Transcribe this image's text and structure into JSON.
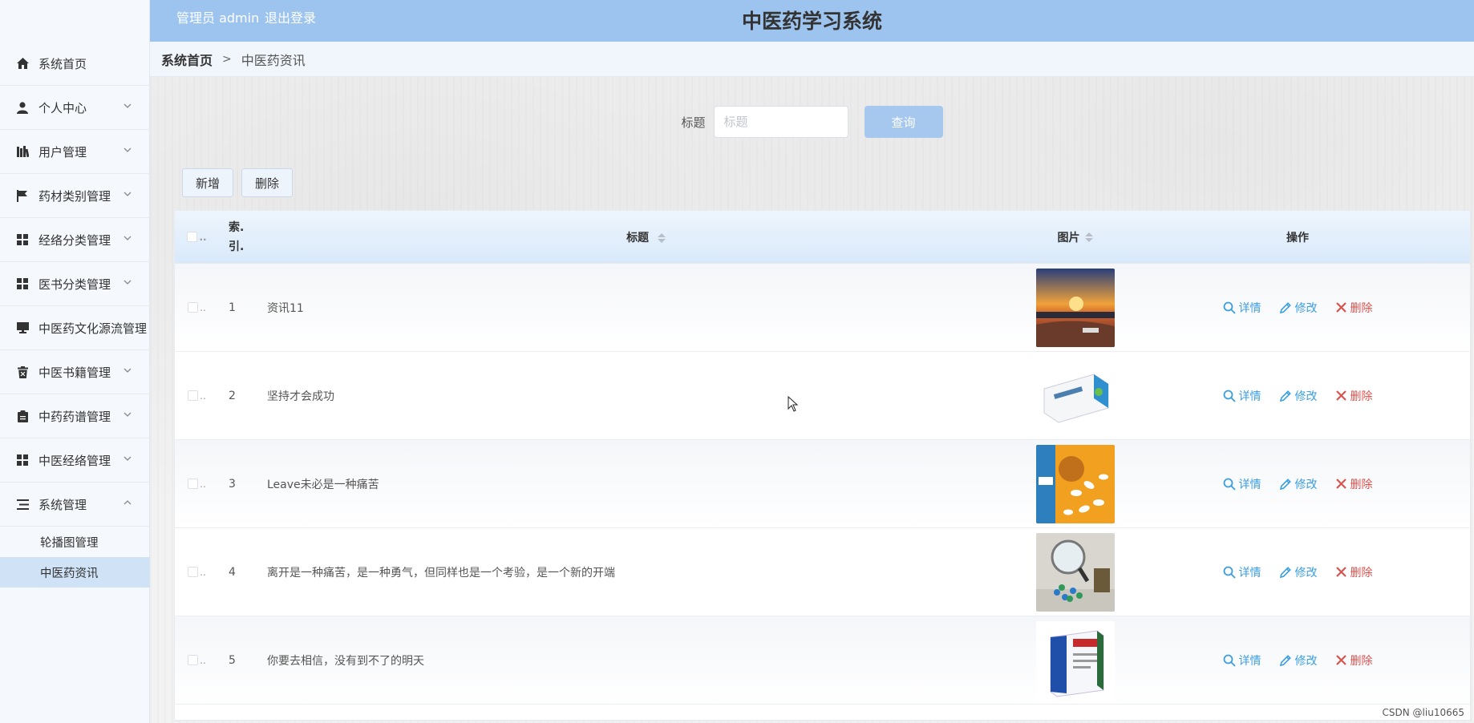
{
  "header": {
    "user_label": "管理员 admin",
    "logout_label": "退出登录",
    "title": "中医药学习系统"
  },
  "sidebar": {
    "items": [
      {
        "label": "系统首页",
        "icon": "home-icon",
        "has_children": false
      },
      {
        "label": "个人中心",
        "icon": "user-icon",
        "has_children": true,
        "expanded": false
      },
      {
        "label": "用户管理",
        "icon": "library-icon",
        "has_children": true,
        "expanded": false
      },
      {
        "label": "药材类别管理",
        "icon": "flag-icon",
        "has_children": true,
        "expanded": false
      },
      {
        "label": "经络分类管理",
        "icon": "grid-icon",
        "has_children": true,
        "expanded": false
      },
      {
        "label": "医书分类管理",
        "icon": "grid-icon",
        "has_children": true,
        "expanded": false
      },
      {
        "label": "中医药文化源流管理",
        "icon": "monitor-icon",
        "has_children": true,
        "expanded": false
      },
      {
        "label": "中医书籍管理",
        "icon": "bin-icon",
        "has_children": true,
        "expanded": false
      },
      {
        "label": "中药药谱管理",
        "icon": "clipboard-icon",
        "has_children": true,
        "expanded": false
      },
      {
        "label": "中医经络管理",
        "icon": "grid-icon",
        "has_children": true,
        "expanded": false
      },
      {
        "label": "系统管理",
        "icon": "list-icon",
        "has_children": true,
        "expanded": true
      }
    ],
    "submenu": [
      {
        "label": "轮播图管理",
        "active": false
      },
      {
        "label": "中医药资讯",
        "active": true
      }
    ]
  },
  "breadcrumb": {
    "home": "系统首页",
    "separator": ">",
    "current": "中医药资讯"
  },
  "search": {
    "label": "标题",
    "placeholder": "标题",
    "value": "",
    "button": "查询"
  },
  "actions": {
    "add": "新增",
    "delete": "删除"
  },
  "table": {
    "headers": {
      "index_line1": "索.",
      "index_line2": "引.",
      "title": "标题",
      "picture": "图片",
      "ops": "操作"
    },
    "check_dots": "..",
    "rows": [
      {
        "index": "1",
        "title": "资讯11",
        "image": "sunset-river-photo"
      },
      {
        "index": "2",
        "title": "坚持才会成功",
        "image": "medicine-box-photo"
      },
      {
        "index": "3",
        "title": "Leave未必是一种痛苦",
        "image": "pills-orange-photo"
      },
      {
        "index": "4",
        "title": "离开是一种痛苦，是一种勇气，但同样也是一个考验，是一个新的开端",
        "image": "magnifier-pills-photo"
      },
      {
        "index": "5",
        "title": "你要去相信，没有到不了的明天",
        "image": "medicine-package-photo"
      }
    ],
    "op_labels": {
      "detail": "详情",
      "edit": "修改",
      "delete": "删除"
    }
  },
  "watermark": "CSDN @liu10665",
  "colors": {
    "header_bg": "#9dc4ee",
    "accent_blue": "#3b9ee0",
    "danger_red": "#d9534f",
    "search_button": "#a6c8ee"
  }
}
